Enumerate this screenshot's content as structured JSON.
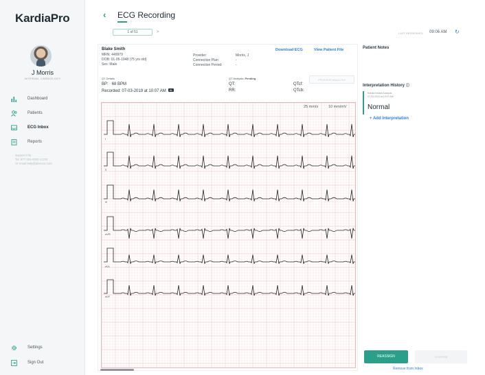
{
  "app": {
    "logo": "KardiaPro"
  },
  "user": {
    "name": "J Morris",
    "role": "INTERNAL CARDIOLOGY"
  },
  "sidebar": {
    "items": [
      {
        "label": "Dashboard",
        "icon": "bar-chart-icon"
      },
      {
        "label": "Patients",
        "icon": "users-icon"
      },
      {
        "label": "ECG Inbox",
        "icon": "inbox-icon",
        "active": true
      },
      {
        "label": "Reports",
        "icon": "reports-icon"
      }
    ],
    "support_lines": [
      "Support info",
      "Tel: 877-301-0000 x1234",
      "Or email help@alivecor.com"
    ],
    "settings_label": "Settings",
    "signout_label": "Sign Out"
  },
  "header": {
    "title": "ECG Recording",
    "pager": "1 of 51",
    "next": ">",
    "last_refresh_label": "LAST REFRESHED",
    "last_refresh_time": "09:06 AM"
  },
  "patient": {
    "name": "Blake Smith",
    "mrn_label": "MRN:",
    "mrn": "449979",
    "dob_label": "DOB:",
    "dob": "01-05-1948 (75 yrs old)",
    "sex_label": "Sex:",
    "sex": "Male",
    "provider_label": "Provider:",
    "provider": "Morris, J",
    "plan_label": "Connection Plan:",
    "plan": "-",
    "period_label": "Connection Period:",
    "period": "-"
  },
  "links": {
    "download": "Download ECG",
    "view_patient": "View Patient File"
  },
  "qt": {
    "details_label": "QT Details",
    "analysis_label": "QT Analysis:",
    "analysis_status": "Pending",
    "bpm_label": "BP:",
    "bpm": "68 BPM",
    "recorded_label": "Recorded:",
    "recorded": "07-03-2019 at 10:07 AM",
    "rec_badge": "6L",
    "qt_label": "QT:",
    "rr_label": "RR:",
    "qtcf_label": "QTcf:",
    "qtcb_label": "QTcb:",
    "process_button": "PROCESS ANALYSIS"
  },
  "ecg": {
    "speed": "25 mm/s",
    "gain": "10 mm/mV",
    "leads": [
      "I",
      "II",
      "III",
      "aVR",
      "aVL",
      "aVF"
    ]
  },
  "right": {
    "notes_title": "Patient Notes",
    "history_title": "Interpretation History",
    "info_glyph": "ⓘ",
    "interp_source_line1": "Kardia Instant Analysis",
    "interp_source_line2": "07-03-2019 at 10:07 AM",
    "interp_result": "Normal",
    "add_interpretation": "+ Add Interpretation",
    "reassign_button": "REASSIGN",
    "confirm_button": "CONFIRM",
    "remove_link": "Remove from Inbox"
  },
  "colors": {
    "accent": "#2aa08a",
    "link": "#2a7de1",
    "grid": "#f3cccc",
    "trace": "#222222"
  }
}
